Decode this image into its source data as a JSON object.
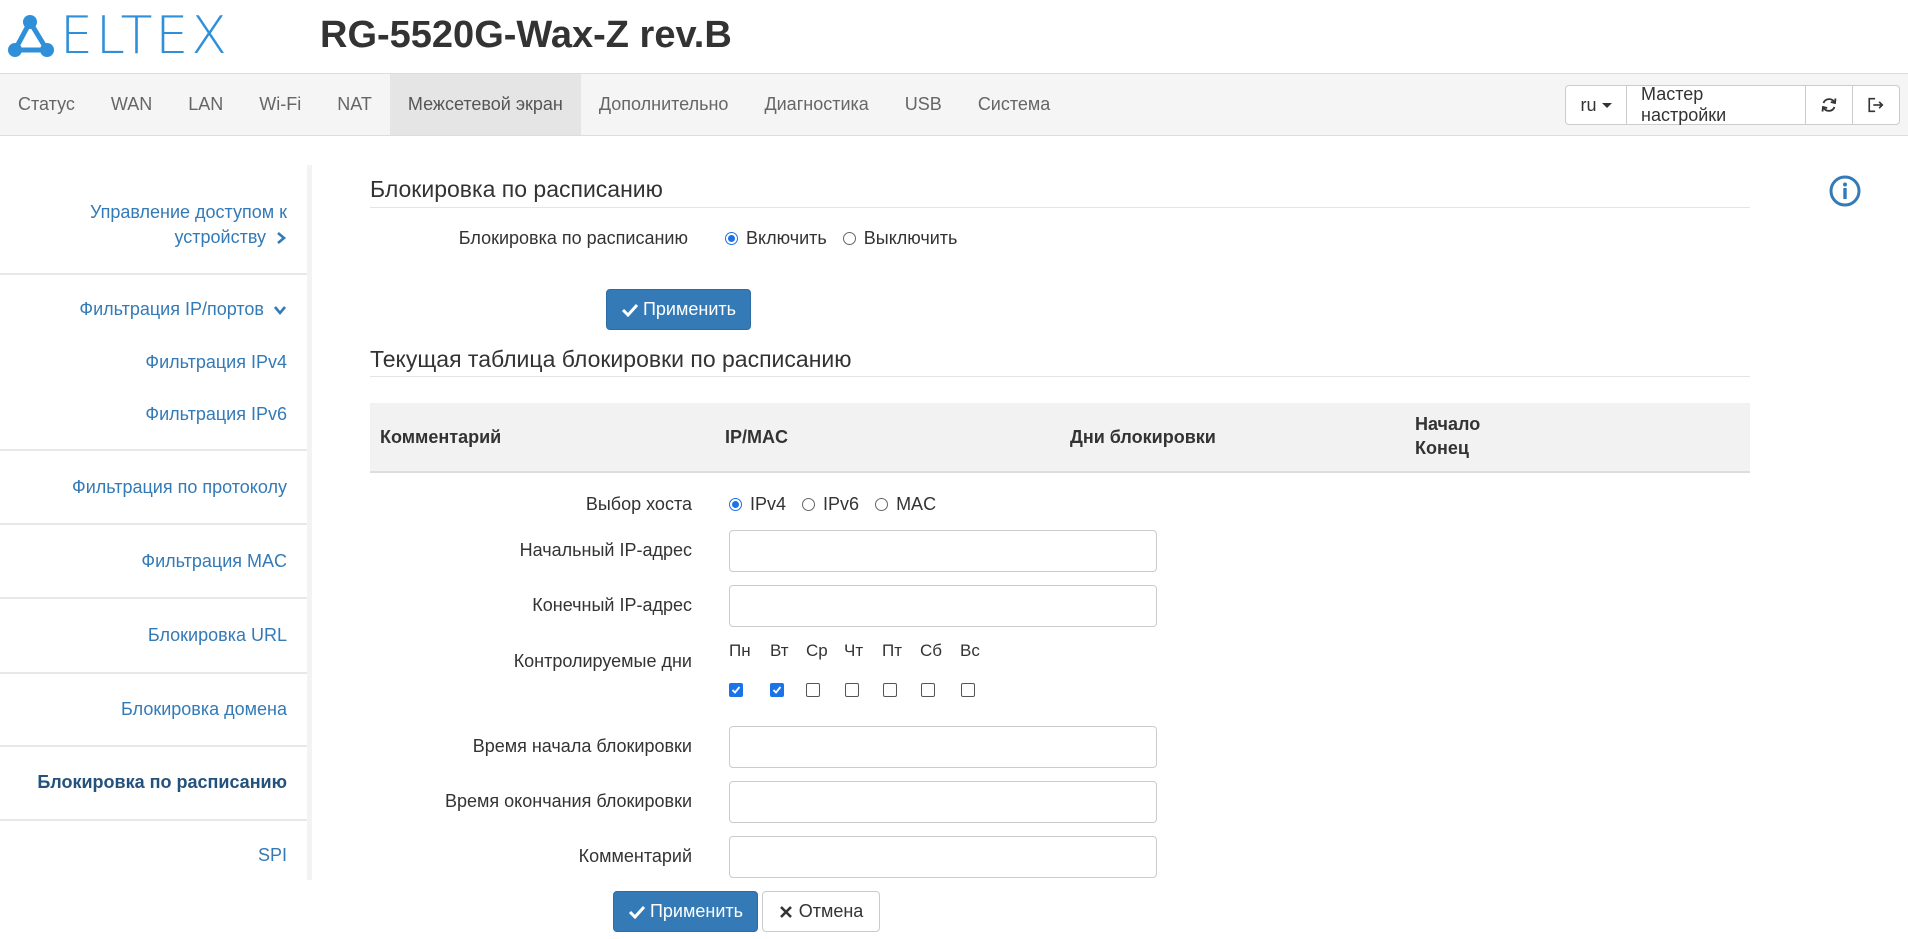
{
  "brand": {
    "logo_text": "ELTEX",
    "device": "RG-5520G-Wax-Z rev.B",
    "accent": "#2f8fd8"
  },
  "nav": {
    "items": [
      {
        "label": "Статус"
      },
      {
        "label": "WAN"
      },
      {
        "label": "LAN"
      },
      {
        "label": "Wi-Fi"
      },
      {
        "label": "NAT"
      },
      {
        "label": "Межсетевой экран",
        "active": true
      },
      {
        "label": "Дополнительно"
      },
      {
        "label": "Диагностика"
      },
      {
        "label": "USB"
      },
      {
        "label": "Система"
      }
    ],
    "lang": "ru",
    "wizard": "Мастер настройки"
  },
  "sidebar": {
    "items": [
      {
        "label": "Управление доступом к устройству"
      },
      {
        "label": "Фильтрация IP/портов"
      },
      {
        "label": "Фильтрация IPv4"
      },
      {
        "label": "Фильтрация IPv6"
      },
      {
        "label": "Фильтрация по протоколу"
      },
      {
        "label": "Фильтрация MAC"
      },
      {
        "label": "Блокировка URL"
      },
      {
        "label": "Блокировка домена"
      },
      {
        "label": "Блокировка по расписанию",
        "active": true
      },
      {
        "label": "SPI"
      }
    ]
  },
  "section1": {
    "title": "Блокировка по расписанию",
    "field_label": "Блокировка по расписанию",
    "options": [
      "Включить",
      "Выключить"
    ],
    "selected": "Включить",
    "apply": "Применить"
  },
  "section2": {
    "title": "Текущая таблица блокировки по расписанию",
    "columns": [
      "Комментарий",
      "IP/MAC",
      "Дни блокировки",
      "Начало",
      "Конец"
    ]
  },
  "form": {
    "host_label": "Выбор хоста",
    "host_options": [
      "IPv4",
      "IPv6",
      "MAC"
    ],
    "host_selected": "IPv4",
    "start_ip_label": "Начальный IP-адрес",
    "start_ip_value": "",
    "end_ip_label": "Конечный IP-адрес",
    "end_ip_value": "",
    "days_label": "Контролируемые дни",
    "days": [
      {
        "name": "Пн",
        "checked": true
      },
      {
        "name": "Вт",
        "checked": true
      },
      {
        "name": "Ср",
        "checked": false
      },
      {
        "name": "Чт",
        "checked": false
      },
      {
        "name": "Пт",
        "checked": false
      },
      {
        "name": "Сб",
        "checked": false
      },
      {
        "name": "Вс",
        "checked": false
      }
    ],
    "start_time_label": "Время начала блокировки",
    "start_time_value": "",
    "end_time_label": "Время окончания блокировки",
    "end_time_value": "",
    "comment_label": "Комментарий",
    "comment_value": "",
    "apply": "Применить",
    "cancel": "Отмена"
  }
}
